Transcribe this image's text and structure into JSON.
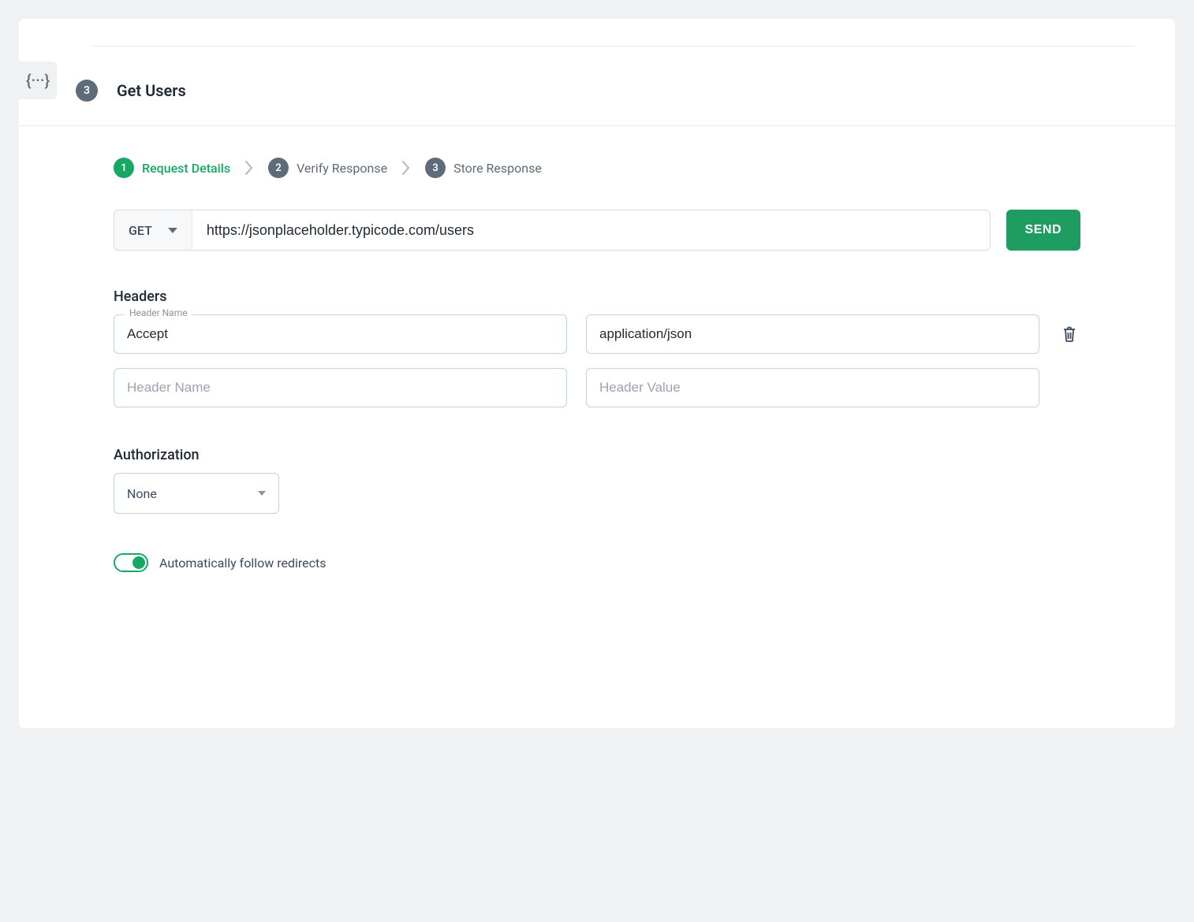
{
  "header": {
    "badge_num": "3",
    "title": "Get Users",
    "json_tab_icon": "{···}"
  },
  "steps": [
    {
      "num": "1",
      "label": "Request Details",
      "active": true
    },
    {
      "num": "2",
      "label": "Verify Response",
      "active": false
    },
    {
      "num": "3",
      "label": "Store Response",
      "active": false
    }
  ],
  "request": {
    "method": "GET",
    "url": "https://jsonplaceholder.typicode.com/users",
    "send_label": "SEND"
  },
  "headers_section": {
    "title": "Headers",
    "float_label": "Header Name",
    "rows": [
      {
        "name": "Accept",
        "value": "application/json",
        "deletable": true
      }
    ],
    "empty_name_placeholder": "Header Name",
    "empty_value_placeholder": "Header Value"
  },
  "authorization": {
    "title": "Authorization",
    "selected": "None"
  },
  "redirects": {
    "label": "Automatically follow redirects",
    "enabled": true
  }
}
